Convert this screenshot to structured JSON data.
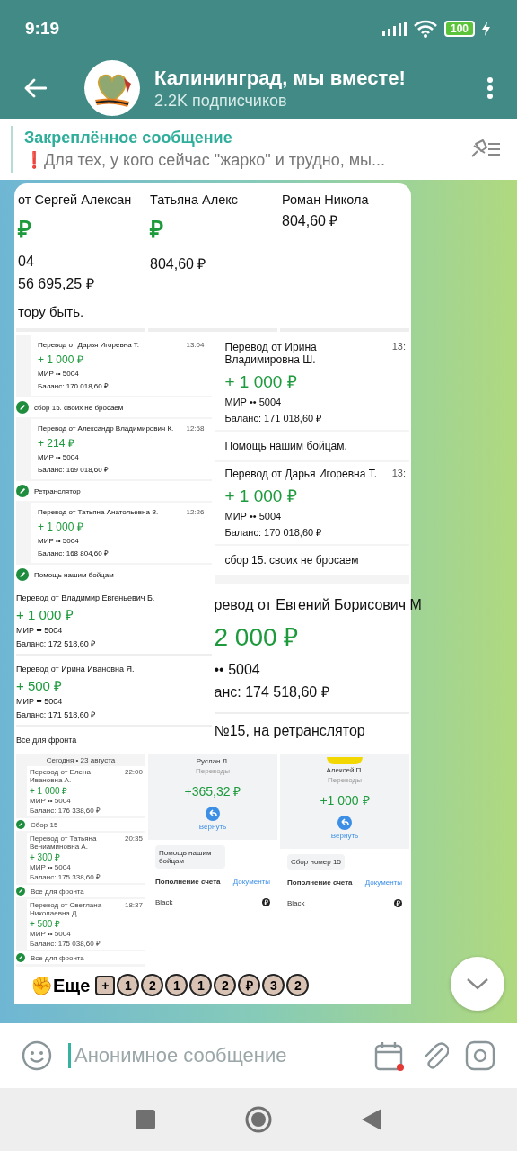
{
  "status_bar": {
    "time": "9:19",
    "battery": "100"
  },
  "header": {
    "title": "Калининград, мы вместе!",
    "subtitle": "2.2K подписчиков"
  },
  "pinned": {
    "label": "Закреплённое сообщение",
    "mark": "❗",
    "text": "Для тех, у кого сейчас \"жарко\" и трудно, мы..."
  },
  "collage": [
    {
      "tiles": [
        {
          "kind": "zoomed_receipt",
          "entries": [
            {
              "title": "от Сергей Алексан",
              "amount": "₽",
              "card": "04",
              "balance": "56 695,25 ₽",
              "note": "тору быть."
            }
          ]
        },
        {
          "kind": "zoomed_receipt",
          "entries": [
            {
              "title": "Татьяна Алекс",
              "amount": "₽",
              "balance": "804,60 ₽"
            }
          ]
        },
        {
          "kind": "zoomed_receipt",
          "entries": [
            {
              "title": "Роман Никола",
              "balance": "804,60 ₽"
            }
          ]
        }
      ]
    },
    {
      "tiles": [
        {
          "kind": "compact_list",
          "entries": [
            {
              "title": "Перевод от Дарья Игоревна Т.",
              "time": "13:04",
              "amount": "+ 1 000 ₽",
              "card": "МИР •• 5004",
              "balance": "Баланс: 170 018,60 ₽",
              "note": "сбор 15. своих не бросаем"
            },
            {
              "title": "Перевод от Александр Владимирович К.",
              "time": "12:58",
              "amount": "+ 214 ₽",
              "card": "МИР •• 5004",
              "balance": "Баланс: 169 018,60 ₽",
              "note": "Ретранслятор"
            },
            {
              "title": "Перевод от Татьяна Анатольевна З.",
              "time": "12:26",
              "amount": "+ 1 000 ₽",
              "card": "МИР •• 5004",
              "balance": "Баланс: 168 804,60 ₽",
              "note": "Помощь нашим бойцам"
            }
          ]
        },
        {
          "kind": "receipt_list",
          "entries": [
            {
              "title": "Перевод от Ирина Владимировна Ш.",
              "time": "13:",
              "amount": "+ 1 000 ₽",
              "card": "МИР •• 5004",
              "balance": "Баланс: 171 018,60 ₽",
              "note": "Помощь нашим бойцам."
            },
            {
              "title": "Перевод от Дарья Игоревна Т.",
              "time": "13:",
              "amount": "+ 1 000 ₽",
              "card": "МИР •• 5004",
              "balance": "Баланс: 170 018,60 ₽",
              "note": "сбор 15. своих не бросаем"
            }
          ]
        }
      ]
    },
    {
      "tiles": [
        {
          "kind": "plain_list",
          "entries": [
            {
              "title": "Перевод от Владимир Евгеньевич Б.",
              "amount": "+ 1 000 ₽",
              "card": "МИР •• 5004",
              "balance": "Баланс: 172 518,60 ₽"
            },
            {
              "title": "Перевод от Ирина Ивановна Я.",
              "amount": "+ 500 ₽",
              "card": "МИР •• 5004",
              "balance": "Баланс: 171 518,60 ₽",
              "note": "Все для фронта"
            }
          ]
        },
        {
          "kind": "wide_receipt",
          "entries": [
            {
              "title": "ревод от Евгений Борисович М",
              "amount": "2 000 ₽",
              "card": "•• 5004",
              "balance": "анс: 174 518,60 ₽",
              "note": "№15, на ретранслятор"
            }
          ]
        }
      ]
    },
    {
      "tiles": [
        {
          "kind": "tiny_list",
          "heading": "Сегодня • 23 августа",
          "entries": [
            {
              "title": "Перевод от Елена Ивановна А.",
              "time": "22:00",
              "amount": "+ 1 000 ₽",
              "card": "МИР •• 5004",
              "balance": "Баланс: 176 338,60 ₽",
              "note": "Сбор 15"
            },
            {
              "title": "Перевод от Татьяна Вениаминовна А.",
              "time": "20:35",
              "amount": "+ 300 ₽",
              "card": "МИР •• 5004",
              "balance": "Баланс: 175 338,60 ₽",
              "note": "Все для фронта"
            },
            {
              "title": "Перевод от Светлана Николаевна Д.",
              "time": "18:37",
              "amount": "+ 500 ₽",
              "card": "МИР •• 5004",
              "balance": "Баланс: 175 038,60 ₽",
              "note": "Все для фронта"
            }
          ]
        },
        {
          "kind": "account_card",
          "avatar": false,
          "name": "Руслан Л.",
          "category": "Переводы",
          "amount": "+365,32 ₽",
          "action": "Вернуть",
          "note": "Помощь нашим бойцам",
          "section": "Пополнение счета",
          "link": "Документы",
          "account": "Black"
        },
        {
          "kind": "account_card",
          "avatar": true,
          "name": "Алексей П.",
          "category": "Переводы",
          "amount": "+1 000 ₽",
          "action": "Вернуть",
          "note": "Сбор номер 15",
          "section": "Пополнение счета",
          "link": "Документы",
          "account": "Black"
        }
      ]
    }
  ],
  "message": {
    "emoji": "✊",
    "text": "Еще",
    "keycaps": [
      {
        "kind": "square",
        "char": "+"
      },
      {
        "kind": "circle",
        "char": "1"
      },
      {
        "kind": "circle",
        "char": "2"
      },
      {
        "kind": "circle",
        "char": "1"
      },
      {
        "kind": "circle",
        "char": "1"
      },
      {
        "kind": "circle",
        "char": "2"
      },
      {
        "kind": "circle",
        "char": "₽"
      },
      {
        "kind": "circle",
        "char": "3"
      },
      {
        "kind": "circle",
        "char": "2"
      }
    ]
  },
  "composer": {
    "placeholder": "Анонимное сообщение"
  }
}
